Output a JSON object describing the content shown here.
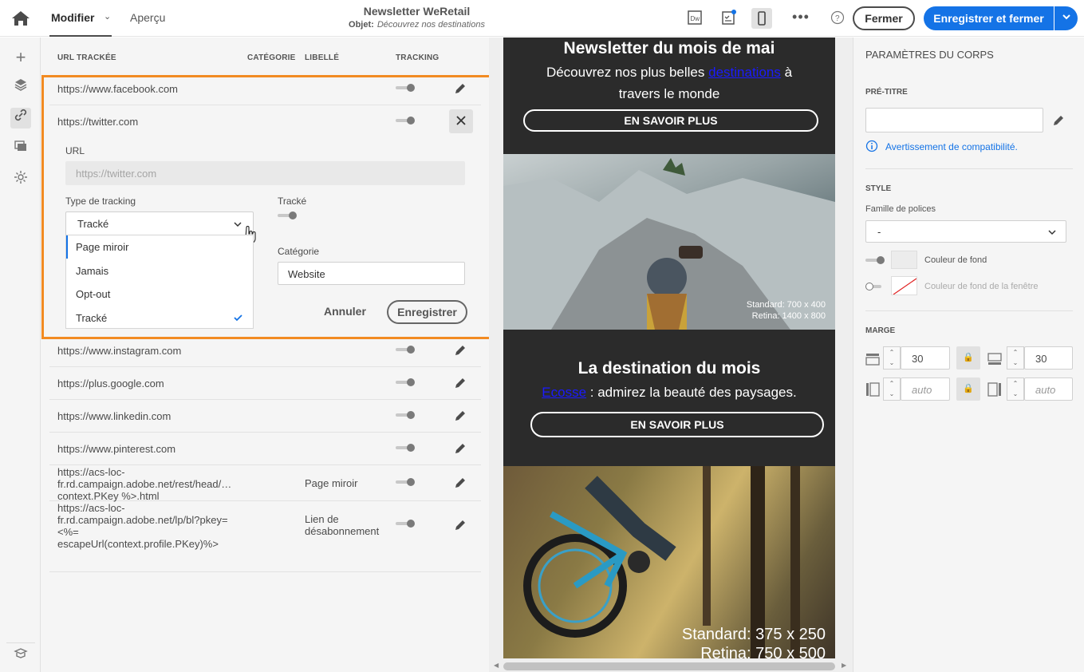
{
  "header": {
    "tab_modifier": "Modifier",
    "tab_apercu": "Aperçu",
    "title": "Newsletter WeRetail",
    "subject_label": "Objet:",
    "subject_value": "Découvrez nos destinations",
    "dw_icon": "Dw",
    "btn_fermer": "Fermer",
    "btn_save": "Enregistrer et fermer"
  },
  "left": {
    "col_url": "URL TRACKÉE",
    "col_category": "CATÉGORIE",
    "col_label": "LIBELLÉ",
    "col_tracking": "TRACKING",
    "rows": [
      {
        "url": "https://www.facebook.com",
        "label": ""
      },
      {
        "url": "https://twitter.com",
        "label": ""
      },
      {
        "url": "https://www.instagram.com",
        "label": ""
      },
      {
        "url": "https://plus.google.com",
        "label": ""
      },
      {
        "url": "https://www.linkedin.com",
        "label": ""
      },
      {
        "url": "https://www.pinterest.com",
        "label": ""
      },
      {
        "url_lines": [
          "https://acs-loc-",
          "fr.rd.campaign.adobe.net/rest/head/…",
          "context.PKey %>.html"
        ],
        "label": "Page miroir"
      },
      {
        "url_lines": [
          "https://acs-loc-",
          "fr.rd.campaign.adobe.net/lp/bl?pkey=",
          "<%=",
          "escapeUrl(context.profile.PKey)%>"
        ],
        "label_lines": [
          "Lien de",
          "désabonnement"
        ]
      }
    ],
    "edit": {
      "url_label": "URL",
      "url_value": "https://twitter.com",
      "tracking_type_label": "Type de tracking",
      "tracking_type_value": "Tracké",
      "tracked_label": "Tracké",
      "category_label": "Catégorie",
      "category_value": "Website",
      "cancel": "Annuler",
      "save": "Enregistrer",
      "options": [
        "Page miroir",
        "Jamais",
        "Opt-out",
        "Tracké"
      ]
    }
  },
  "preview": {
    "h1": "Newsletter du mois de mai",
    "sub1_a": "Découvrez nos plus belles",
    "sub1_link": "destinations",
    "sub1_b": "à",
    "sub1_c": "travers le monde",
    "cta": "EN SAVOIR PLUS",
    "wm1_a": "Standard: 700 x 400",
    "wm1_b": "Retina: 1400 x 800",
    "h2": "La destination du mois",
    "sub2_link": "Ecosse",
    "sub2_b": ": admirez la beauté des paysages.",
    "wm2_a": "Standard: 375 x 250",
    "wm2_b": "Retina: 750 x 500"
  },
  "right": {
    "section": "PARAMÈTRES DU CORPS",
    "pretitle": "PRÉ-TITRE",
    "compat": "Avertissement de compatibilité.",
    "style": "STYLE",
    "font_family": "Famille de polices",
    "font_value": "-",
    "bg_color": "Couleur de fond",
    "window_bg_color": "Couleur de fond de la fenêtre",
    "margin": "MARGE",
    "top": "30",
    "bottom": "30",
    "left_v": "auto",
    "right_v": "auto"
  }
}
